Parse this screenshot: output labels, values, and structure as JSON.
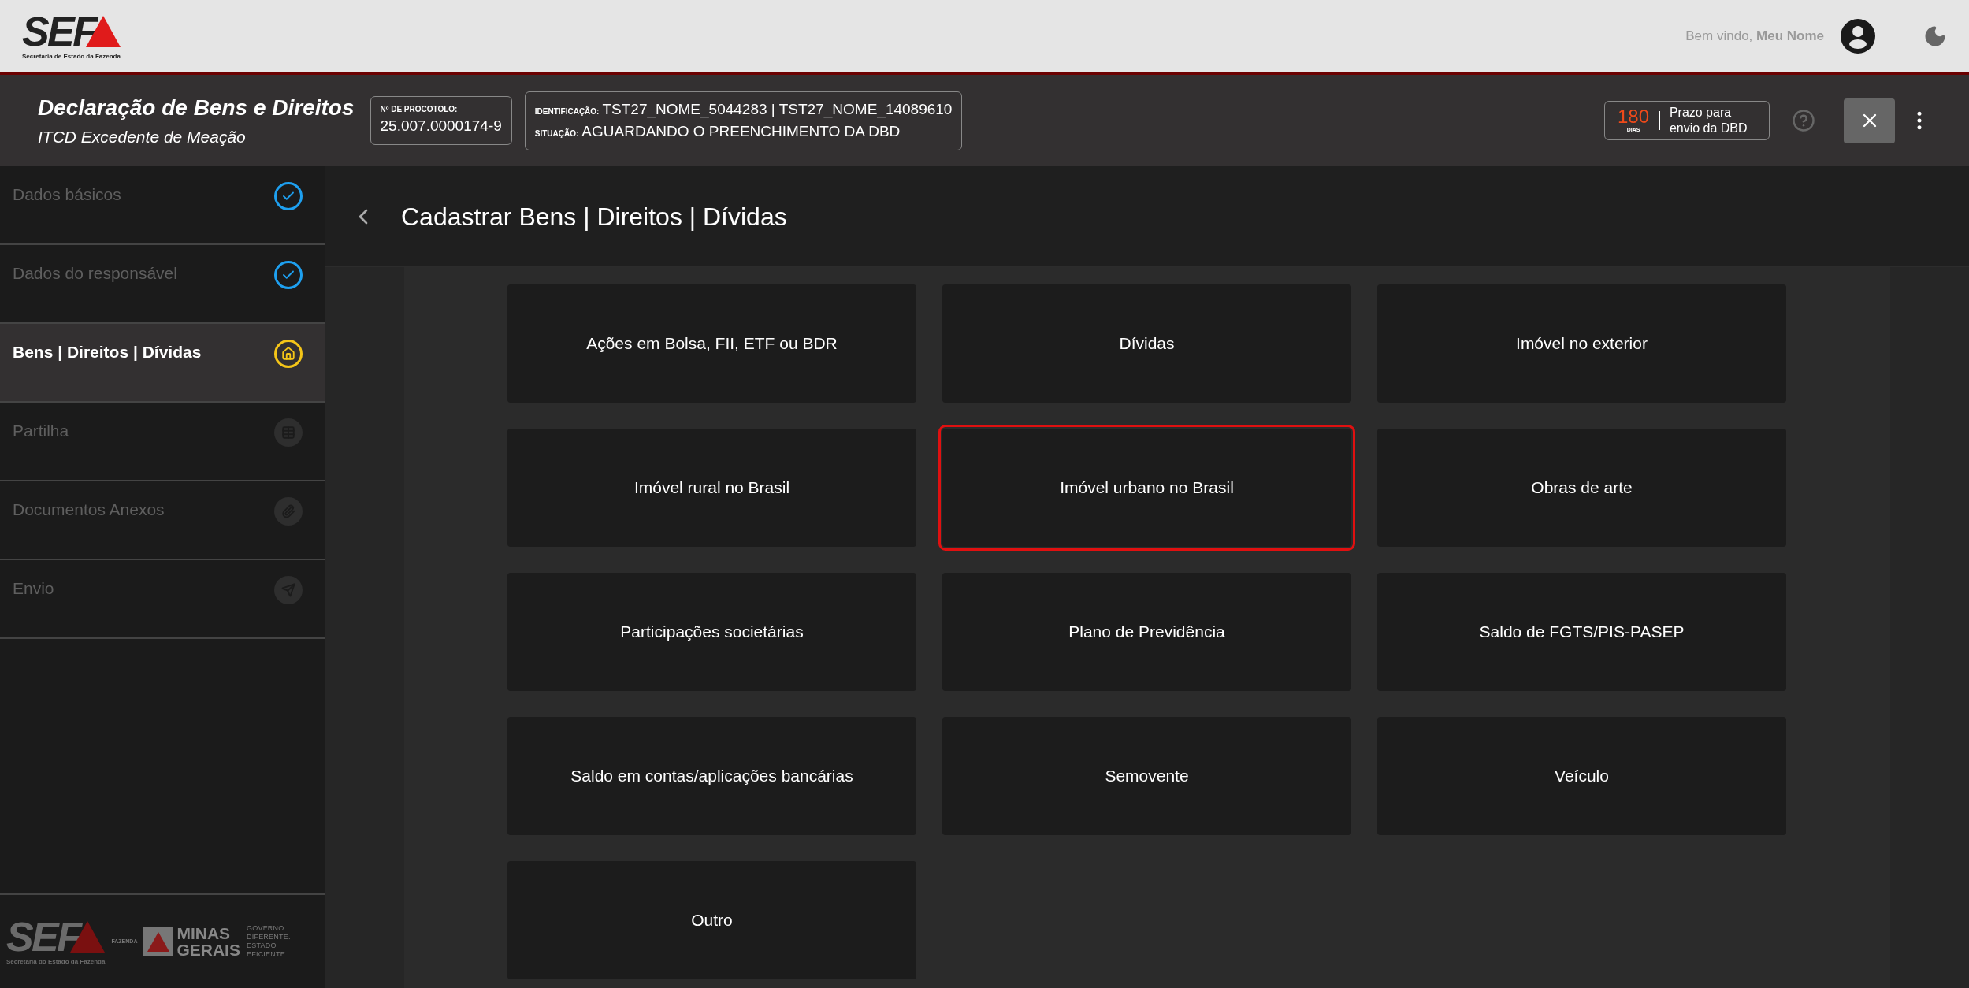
{
  "top_bar": {
    "logo": {
      "mark": "SEF",
      "subtitle": "Secretaria de Estado da Fazenda"
    },
    "welcome": "Bem vindo, ",
    "user_name": "Meu Nome"
  },
  "header": {
    "title": "Declaração de Bens e Direitos",
    "subtitle": "ITCD Excedente de Meação",
    "protocol": {
      "label": "Nº DE PROCOTOLO:",
      "value": "25.007.0000174-9"
    },
    "identification": {
      "label": "IDENTIFICAÇÃO:",
      "value": "TST27_NOME_5044283 | TST27_NOME_14089610",
      "status_label": "SITUAÇÃO:",
      "status_value": "AGUARDANDO O PREENCHIMENTO DA DBD"
    },
    "deadline": {
      "days": "180",
      "unit": "DIAS",
      "text": "Prazo para envio da DBD"
    }
  },
  "sidebar": {
    "items": [
      {
        "label": "Dados básicos",
        "kind": "done",
        "selected": false
      },
      {
        "label": "Dados do responsável",
        "kind": "done",
        "selected": false
      },
      {
        "label": "Bens | Direitos | Dívidas",
        "kind": "current",
        "selected": true
      },
      {
        "label": "Partilha",
        "kind": "pending",
        "selected": false
      },
      {
        "label": "Documentos Anexos",
        "kind": "pending",
        "selected": false
      },
      {
        "label": "Envio",
        "kind": "pending",
        "selected": false
      }
    ],
    "footer": {
      "sef": "SEF",
      "sef_subtitle": "Secretaria do Estado da Fazenda",
      "fazenda": "FAZENDA",
      "minas_line1": "MINAS",
      "minas_line2": "GERAIS",
      "slogan": [
        "GOVERNO",
        "DIFERENTE.",
        "ESTADO",
        "EFICIENTE."
      ]
    }
  },
  "page": {
    "title": "Cadastrar Bens | Direitos | Dívidas",
    "cards": [
      {
        "label": "Ações em Bolsa, FII, ETF ou BDR",
        "selected": false
      },
      {
        "label": "Dívidas",
        "selected": false
      },
      {
        "label": "Imóvel no exterior",
        "selected": false
      },
      {
        "label": "Imóvel rural no Brasil",
        "selected": false
      },
      {
        "label": "Imóvel urbano no Brasil",
        "selected": true
      },
      {
        "label": "Obras de arte",
        "selected": false
      },
      {
        "label": "Participações societárias",
        "selected": false
      },
      {
        "label": "Plano de Previdência",
        "selected": false
      },
      {
        "label": "Saldo de FGTS/PIS-PASEP",
        "selected": false
      },
      {
        "label": "Saldo em contas/aplicações bancárias",
        "selected": false
      },
      {
        "label": "Semovente",
        "selected": false
      },
      {
        "label": "Veículo",
        "selected": false
      },
      {
        "label": "Outro",
        "selected": false
      }
    ]
  }
}
